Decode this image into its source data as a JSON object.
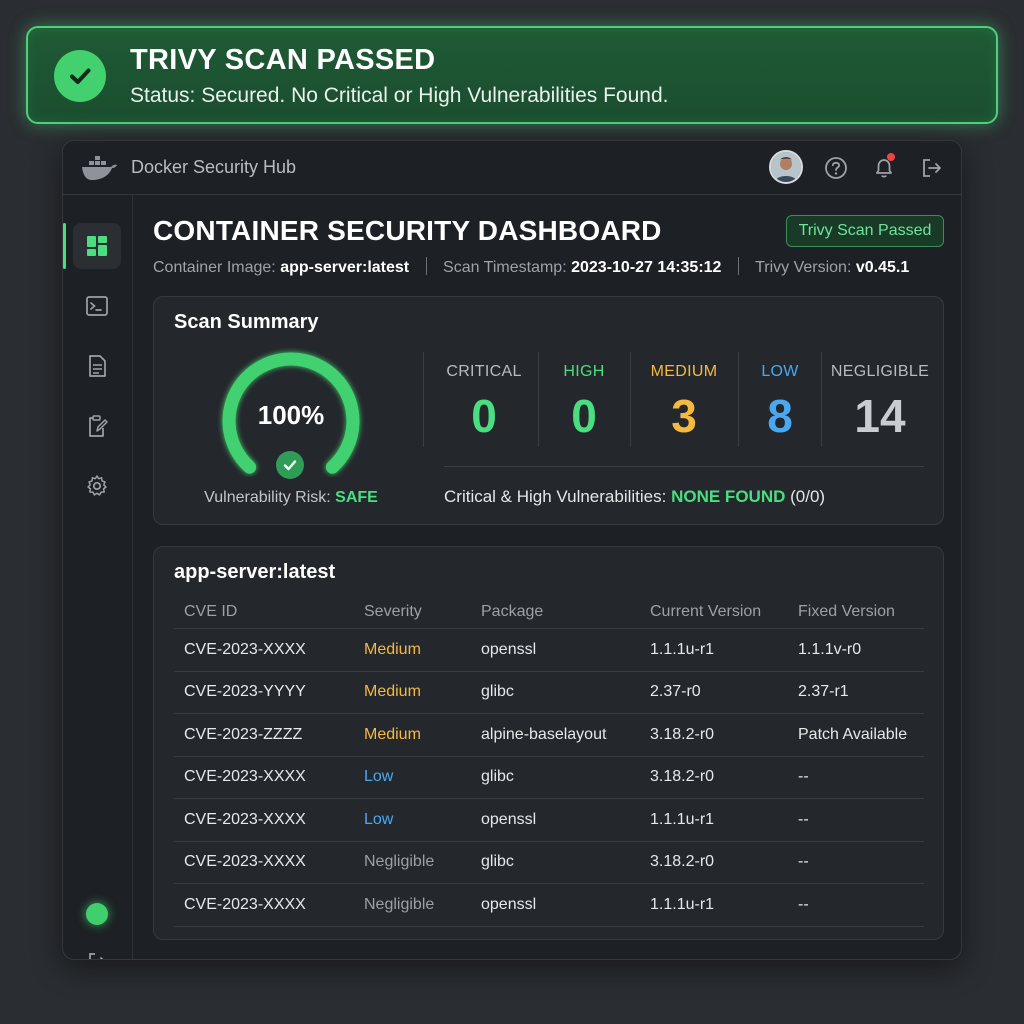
{
  "banner": {
    "title": "TRIVY SCAN PASSED",
    "subtitle": "Status: Secured. No Critical or High Vulnerabilities Found.",
    "icon": "check-circle-icon",
    "accent": "#4ade80"
  },
  "app": {
    "title": "Docker Security Hub",
    "logo_icon": "docker-whale-icon",
    "header_icons": [
      "avatar",
      "help-icon",
      "bell-icon",
      "logout-icon"
    ],
    "notification_color": "#ef4444"
  },
  "sidebar": {
    "items": [
      {
        "name": "dashboard",
        "icon": "dashboard-icon",
        "active": true
      },
      {
        "name": "terminal",
        "icon": "terminal-icon",
        "active": false
      },
      {
        "name": "reports",
        "icon": "document-icon",
        "active": false
      },
      {
        "name": "policies",
        "icon": "clipboard-edit-icon",
        "active": false
      },
      {
        "name": "settings",
        "icon": "gear-icon",
        "active": false
      }
    ],
    "bottom": [
      "status-dot",
      "logout-icon"
    ]
  },
  "header": {
    "title": "CONTAINER SECURITY DASHBOARD",
    "badge": "Trivy Scan Passed",
    "image_label": "Container Image:",
    "image_value": "app-server:latest",
    "timestamp_label": "Scan Timestamp:",
    "timestamp_value": "2023-10-27 14:35:12",
    "version_label": "Trivy Version:",
    "version_value": "v0.45.1"
  },
  "summary": {
    "title": "Scan Summary",
    "gauge_percent": "100%",
    "gauge_value": 1.0,
    "risk_label": "Vulnerability Risk:",
    "risk_value": "SAFE",
    "severities": [
      {
        "label": "CRITICAL",
        "count": "0",
        "label_color": "#b8bcc1",
        "count_color": "#4ade80"
      },
      {
        "label": "HIGH",
        "count": "0",
        "label_color": "#4ade80",
        "count_color": "#4ade80"
      },
      {
        "label": "MEDIUM",
        "count": "3",
        "label_color": "#f5b942",
        "count_color": "#f5b942"
      },
      {
        "label": "LOW",
        "count": "8",
        "label_color": "#4aa8f0",
        "count_color": "#4aa8f0"
      },
      {
        "label": "NEGLIGIBLE",
        "count": "14",
        "label_color": "#b8bcc1",
        "count_color": "#c9ccd0"
      }
    ],
    "crit_label": "Critical & High Vulnerabilities:",
    "crit_value": "NONE FOUND",
    "crit_count": "(0/0)"
  },
  "table": {
    "title": "app-server:latest",
    "columns": [
      "CVE ID",
      "Severity",
      "Package",
      "Current Version",
      "Fixed Version"
    ],
    "severity_colors": {
      "Medium": "#f5b942",
      "Low": "#4aa8f0",
      "Negligible": "#9ca1a7"
    },
    "rows": [
      [
        "CVE-2023-XXXX",
        "Medium",
        "openssl",
        "1.1.1u-r1",
        "1.1.1v-r0"
      ],
      [
        "CVE-2023-YYYY",
        "Medium",
        "glibc",
        "2.37-r0",
        "2.37-r1"
      ],
      [
        "CVE-2023-ZZZZ",
        "Medium",
        "alpine-baselayout",
        "3.18.2-r0",
        "Patch Available"
      ],
      [
        "CVE-2023-XXXX",
        "Low",
        "glibc",
        "3.18.2-r0",
        "--"
      ],
      [
        "CVE-2023-XXXX",
        "Low",
        "openssl",
        "1.1.1u-r1",
        "--"
      ],
      [
        "CVE-2023-XXXX",
        "Negligible",
        "glibc",
        "3.18.2-r0",
        "--"
      ],
      [
        "CVE-2023-XXXX",
        "Negligible",
        "openssl",
        "1.1.1u-r1",
        "--"
      ]
    ]
  }
}
